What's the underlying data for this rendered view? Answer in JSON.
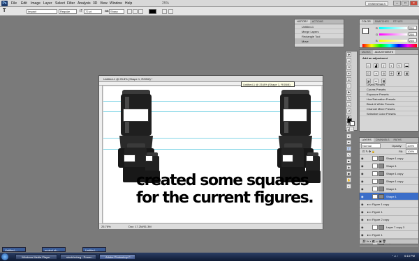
{
  "app": {
    "logo": "Ps",
    "menu": [
      "File",
      "Edit",
      "Image",
      "Layer",
      "Select",
      "Filter",
      "Analysis",
      "3D",
      "View",
      "Window",
      "Help"
    ],
    "workspace": "ESSENTIALS",
    "zoom": "25%"
  },
  "options": {
    "font_family": "Impact",
    "font_style": "Regular",
    "font_size": "72 pt",
    "antialias": "Sharp"
  },
  "document": {
    "title": "Untitled-1 @ 25.8% (Shape 1, RGB/8) *",
    "tooltip": "Untitled-1 @ 25.8% (Shape 1, RGB/8)",
    "zoom": "25.76%",
    "doc_info": "Doc: 17.2M/51.3M",
    "line1": "created some squares",
    "line2": "for the current figures."
  },
  "history": {
    "tabs": [
      "HISTORY",
      "ACTIONS"
    ],
    "items": [
      "Untitled-1",
      "Merge Layers",
      "Rectangle Tool",
      "Move"
    ]
  },
  "color": {
    "tabs": [
      "COLOR",
      "SWATCHES",
      "STYLES"
    ],
    "r": "255",
    "g": "255",
    "b": "255",
    "labels": [
      "R",
      "G",
      "B"
    ]
  },
  "adjustments": {
    "tabs": [
      "MASKS",
      "ADJUSTMENTS"
    ],
    "heading": "Add an adjustment",
    "presets": [
      "Levels Presets",
      "Curves Presets",
      "Exposure Presets",
      "Hue/Saturation Presets",
      "Black & White Presets",
      "Channel Mixer Presets",
      "Selective Color Presets"
    ]
  },
  "layers": {
    "tabs": [
      "LAYERS",
      "CHANNELS",
      "PATHS"
    ],
    "blend": "Normal",
    "opacity_label": "Opacity:",
    "opacity": "100%",
    "fill_label": "Fill:",
    "fill": "100%",
    "rows": [
      {
        "name": "Shape 1 copy",
        "kind": "layer"
      },
      {
        "name": "Shape 1",
        "kind": "layer"
      },
      {
        "name": "Shape 1 copy",
        "kind": "layer"
      },
      {
        "name": "Shape 1 copy",
        "kind": "layer"
      },
      {
        "name": "Shape 1",
        "kind": "layer"
      },
      {
        "name": "Shape 1",
        "kind": "selected"
      },
      {
        "name": "Figure 1 copy",
        "kind": "group"
      },
      {
        "name": "Figure 1",
        "kind": "group"
      },
      {
        "name": "Figure 2 copy",
        "kind": "group"
      },
      {
        "name": "Layer 7 copy 3",
        "kind": "layer"
      },
      {
        "name": "Figure 1",
        "kind": "group"
      },
      {
        "name": "Layer 3",
        "kind": "layer"
      }
    ]
  },
  "taskbar": {
    "minimized": [
      "Untitled-...",
      "project ph...",
      "Untitled-..."
    ],
    "buttons": [
      "Windows Media Player",
      "stockfxcheg - Power...",
      "Adobe Photoshop C..."
    ],
    "clock": "6:13 PM"
  },
  "colors": {
    "accent": "#3b6ec9",
    "guide": "#7fd4e6"
  }
}
